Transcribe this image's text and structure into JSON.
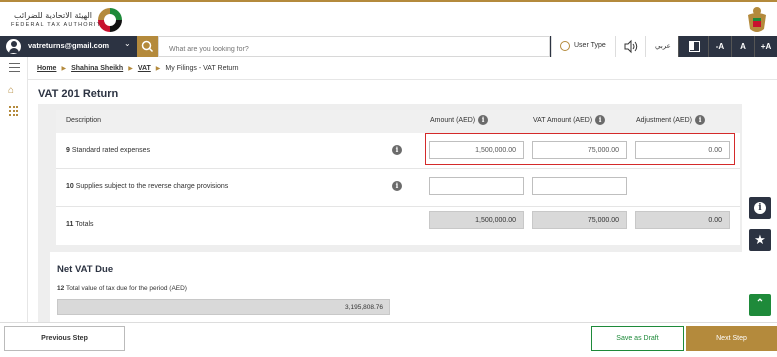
{
  "header": {
    "logo_arabic": "الهيئة الاتحادية للضرائب",
    "logo_english": "FEDERAL TAX AUTHORITY",
    "brand_color": "#b48a3c"
  },
  "navbar": {
    "user_email": "vatreturns@gmail.com",
    "search_placeholder": "What are you looking for?",
    "user_type_label": "User Type",
    "language_label": "عربي",
    "font_sizes": [
      "-A",
      "A",
      "+A"
    ]
  },
  "breadcrumb": {
    "items": [
      "Home",
      "Shahina Sheikh",
      "VAT",
      "My Filings - VAT Return"
    ]
  },
  "page": {
    "title": "VAT 201 Return"
  },
  "table": {
    "headers": {
      "description": "Description",
      "amount": "Amount (AED)",
      "vat_amount": "VAT Amount (AED)",
      "adjustment": "Adjustment (AED)"
    },
    "rows": [
      {
        "num": "9",
        "label": "Standard rated expenses",
        "amount": "1,500,000.00",
        "vat": "75,000.00",
        "adjustment": "0.00"
      },
      {
        "num": "10",
        "label": "Supplies subject to the reverse charge provisions",
        "amount": "",
        "vat": ""
      },
      {
        "num": "11",
        "label": "Totals",
        "amount": "1,500,000.00",
        "vat": "75,000.00",
        "adjustment": "0.00"
      }
    ]
  },
  "net_vat": {
    "title": "Net VAT Due",
    "num": "12",
    "label": "Total value of tax due for the period (AED)",
    "value": "3,195,808.76"
  },
  "footer": {
    "previous": "Previous Step",
    "draft": "Save as Draft",
    "next": "Next Step"
  },
  "icons": {
    "info": "info-icon",
    "star": "star-icon",
    "scroll_top": "chevron-up-icon",
    "search": "search-icon",
    "speaker": "speaker-icon",
    "home": "home-icon",
    "menu": "menu-icon",
    "grid": "grid-icon"
  },
  "colors": {
    "navbar": "#2c3342",
    "gold": "#b48a3c",
    "green": "#1e8a3a",
    "highlight": "#d42a2a"
  }
}
